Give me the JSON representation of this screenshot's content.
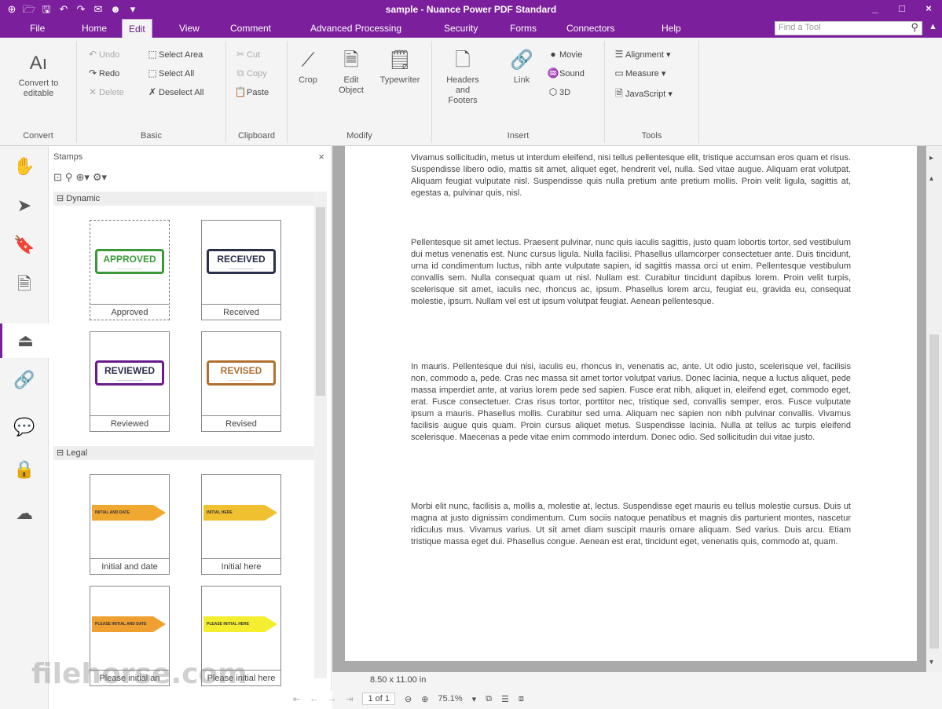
{
  "window": {
    "title": "sample - Nuance Power PDF Standard",
    "controls": [
      "_",
      "□",
      "×"
    ]
  },
  "quick_access": [
    "⊕",
    "🗁",
    "🖫",
    "↶",
    "↷",
    "✉",
    "☻",
    "▾"
  ],
  "menu": {
    "items": [
      "File",
      "Home",
      "Edit",
      "View",
      "Comment",
      "Advanced Processing",
      "Security",
      "Forms",
      "Connectors",
      "Help"
    ],
    "active": "Edit",
    "find_placeholder": "Find a Tool"
  },
  "ribbon": {
    "convert": {
      "label": "Convert",
      "btn": "Convert to editable"
    },
    "basic": {
      "label": "Basic",
      "undo": "Undo",
      "redo": "Redo",
      "delete": "Delete",
      "select_area": "Select Area",
      "select_all": "Select All",
      "deselect_all": "Deselect All"
    },
    "clipboard": {
      "label": "Clipboard",
      "cut": "Cut",
      "copy": "Copy",
      "paste": "Paste"
    },
    "modify": {
      "label": "Modify",
      "crop": "Crop",
      "edit_object": "Edit Object",
      "typewriter": "Typewriter"
    },
    "insert": {
      "label": "Insert",
      "headers_footers": "Headers and Footers",
      "link": "Link",
      "movie": "Movie",
      "sound": "Sound",
      "threed": "3D"
    },
    "tools": {
      "label": "Tools",
      "alignment": "Alignment",
      "measure": "Measure",
      "javascript": "JavaScript"
    }
  },
  "panel": {
    "title": "Stamps",
    "sections": [
      "Dynamic",
      "Legal"
    ],
    "stamps": {
      "approved": {
        "stamp": "APPROVED",
        "caption": "Approved",
        "color": "#3a9a3a"
      },
      "received": {
        "stamp": "RECEIVED",
        "caption": "Received",
        "color": "#2a2f4a"
      },
      "reviewed": {
        "stamp": "REVIEWED",
        "caption": "Reviewed",
        "color": "#6a1b8a"
      },
      "revised": {
        "stamp": "REVISED",
        "caption": "Revised",
        "color": "#b07030"
      },
      "initial_date": {
        "stamp": "INITIAL AND DATE",
        "caption": "Initial and date",
        "color": "#f0a830"
      },
      "initial_here": {
        "stamp": "INITIAL HERE",
        "caption": "Initial here",
        "color": "#f0c030"
      },
      "please_initial_and_date": {
        "stamp": "PLEASE INITIAL AND DATE",
        "caption": "Please initial an",
        "color": "#f0a030"
      },
      "please_initial_here": {
        "stamp": "PLEASE INITIAL HERE",
        "caption": "Please initial here",
        "color": "#f5ee30"
      }
    }
  },
  "document": {
    "paragraphs": [
      "Vivamus sollicitudin, metus ut interdum eleifend, nisi tellus pellentesque elit, tristique accumsan eros quam et risus. Suspendisse libero odio, mattis sit amet, aliquet eget, hendrerit vel, nulla. Sed vitae augue. Aliquam erat volutpat. Aliquam feugiat vulputate nisl. Suspendisse quis nulla pretium ante pretium mollis. Proin velit ligula, sagittis at, egestas a, pulvinar quis, nisl.",
      "Pellentesque sit amet lectus. Praesent pulvinar, nunc quis iaculis sagittis, justo quam lobortis tortor, sed vestibulum dui metus venenatis est. Nunc cursus ligula. Nulla facilisi. Phasellus ullamcorper consectetuer ante. Duis tincidunt, urna id condimentum luctus, nibh ante vulputate sapien, id sagittis massa orci ut enim. Pellentesque vestibulum convallis sem. Nulla consequat quam ut nisl. Nullam est. Curabitur tincidunt dapibus lorem. Proin velit turpis, scelerisque sit amet, iaculis nec, rhoncus ac, ipsum. Phasellus lorem arcu, feugiat eu, gravida eu, consequat molestie, ipsum. Nullam vel est ut ipsum volutpat feugiat. Aenean pellentesque.",
      "In mauris. Pellentesque dui nisi, iaculis eu, rhoncus in, venenatis ac, ante. Ut odio justo, scelerisque vel, facilisis non, commodo a, pede. Cras nec massa sit amet tortor volutpat varius. Donec lacinia, neque a luctus aliquet, pede massa imperdiet ante, at varius lorem pede sed sapien. Fusce erat nibh, aliquet in, eleifend eget, commodo eget, erat. Fusce consectetuer. Cras risus tortor, porttitor nec, tristique sed, convallis semper, eros. Fusce vulputate ipsum a mauris. Phasellus mollis. Curabitur sed urna. Aliquam nec sapien non nibh pulvinar convallis. Vivamus facilisis augue quis quam. Proin cursus aliquet metus. Suspendisse lacinia. Nulla at tellus ac turpis eleifend scelerisque. Maecenas a pede vitae enim commodo interdum. Donec odio. Sed sollicitudin dui vitae justo.",
      "Morbi elit nunc, facilisis a, mollis a, molestie at, lectus. Suspendisse eget mauris eu tellus molestie cursus. Duis ut magna at justo dignissim condimentum. Cum sociis natoque penatibus et magnis dis parturient montes, nascetur ridiculus mus. Vivamus varius. Ut sit amet diam suscipit mauris ornare aliquam. Sed varius. Duis arcu. Etiam tristique massa eget dui. Phasellus congue. Aenean est erat, tincidunt eget, venenatis quis, commodo at, quam."
    ]
  },
  "status": {
    "page_size": "8.50 x 11.00 in",
    "page_indicator": "1 of 1",
    "zoom": "75.1%"
  },
  "watermark": "filehorse.com",
  "colors": {
    "accent": "#7b1f9c"
  }
}
